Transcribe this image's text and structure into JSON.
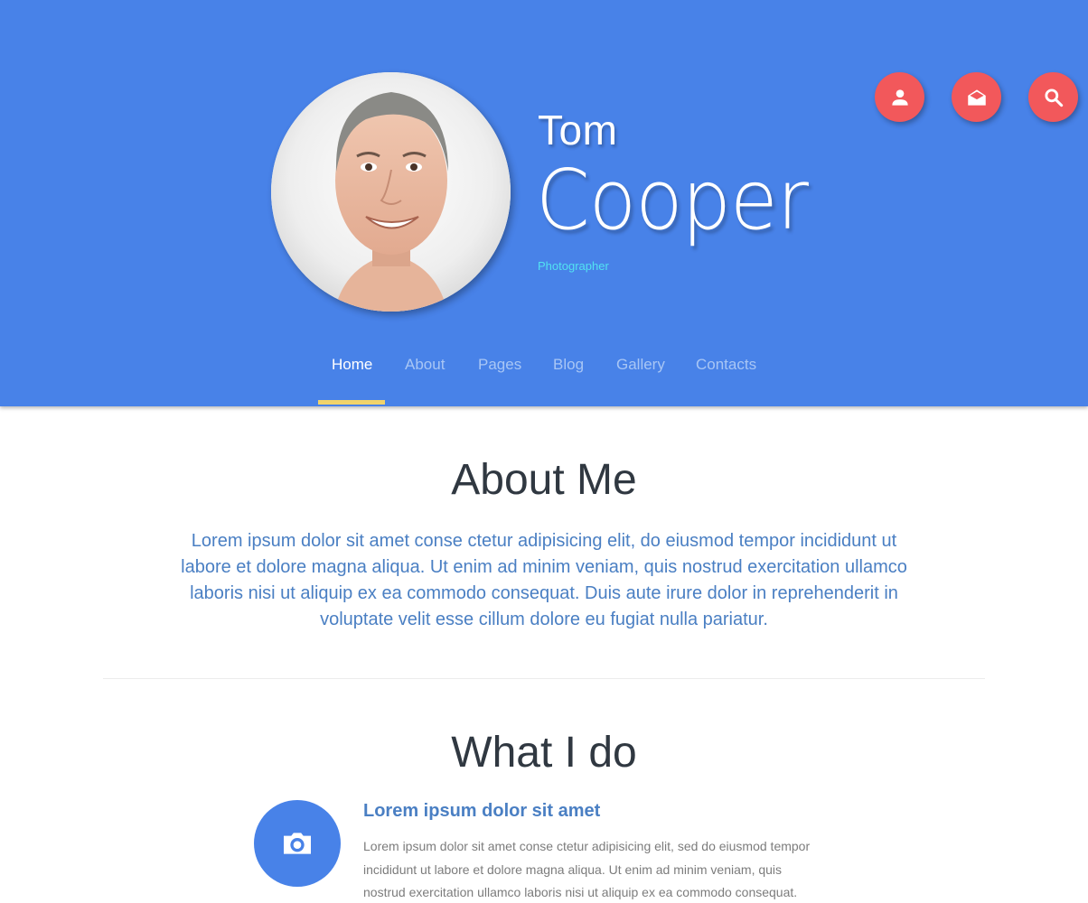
{
  "profile": {
    "first_name": "Tom",
    "last_name": "Cooper",
    "role": "Photographer",
    "avatar_alt": "Portrait of Tom Cooper"
  },
  "header_actions": [
    {
      "icon": "user-icon",
      "label": "Profile"
    },
    {
      "icon": "mail-icon",
      "label": "Mail"
    },
    {
      "icon": "search-icon",
      "label": "Search"
    }
  ],
  "nav": {
    "items": [
      {
        "label": "Home",
        "active": true
      },
      {
        "label": "About",
        "active": false
      },
      {
        "label": "Pages",
        "active": false
      },
      {
        "label": "Blog",
        "active": false
      },
      {
        "label": "Gallery",
        "active": false
      },
      {
        "label": "Contacts",
        "active": false
      }
    ]
  },
  "about": {
    "title": "About Me",
    "text": "Lorem ipsum dolor sit amet conse ctetur adipisicing elit, do eiusmod tempor incididunt ut labore et dolore magna aliqua. Ut enim ad minim veniam, quis nostrud exercitation ullamco laboris nisi ut aliquip ex ea commodo consequat. Duis aute irure dolor in reprehenderit in voluptate velit esse cillum dolore eu fugiat nulla pariatur."
  },
  "what_i_do": {
    "title": "What I do",
    "services": [
      {
        "icon": "camera-icon",
        "title": "Lorem ipsum dolor sit amet",
        "text": "Lorem ipsum dolor sit amet conse ctetur adipisicing elit, sed do eiusmod tempor incididunt ut labore et dolore magna aliqua. Ut enim ad minim veniam, quis nostrud exercitation ullamco laboris nisi ut aliquip ex ea commodo consequat."
      }
    ]
  },
  "colors": {
    "primary": "#4882e8",
    "accent": "#f2585b",
    "nav_indicator": "#f1d36b",
    "role_text": "#52e2f2",
    "heading": "#303841",
    "body_link_text": "#4a7fc3"
  }
}
